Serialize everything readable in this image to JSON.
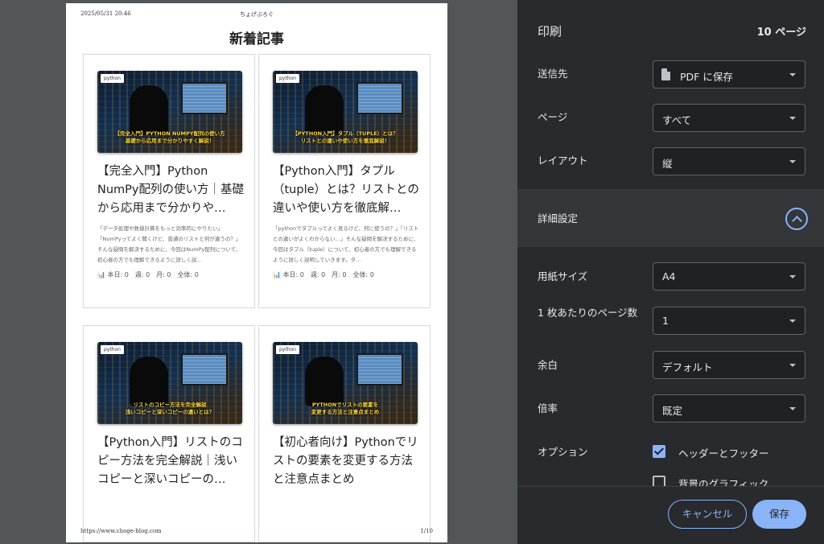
{
  "page_preview": {
    "header_date": "2025/05/31 20:46",
    "header_site": "ちょげぶろぐ",
    "section_title": "新着記事",
    "footer_url": "https://www.choge-blog.com",
    "footer_page": "1/10",
    "cards": [
      {
        "tag": "python",
        "banner": "【完全入門】PYTHON NUMPY配列の使い方\n基礎から応用まで分かりやすく解説！",
        "title": "【完全入門】Python NumPy配列の使い方｜基礎から応用まで分かりや…",
        "excerpt": "「データ処理や数値計算をもっと効率的にやりたい」「NumPyってよく聞くけど、普通のリストと何が違うの？」そんな疑問を解決するために、今回はNumPy配列について、初心者の方でも理解できるように詳しく説…",
        "stats": "📊 本日: 0　週: 0　月: 0　全体: 0"
      },
      {
        "tag": "python",
        "banner": "【PYTHON入門】タプル（TUPLE）とは？\nリストとの違いや使い方を徹底解説！",
        "title": "【Python入門】タプル（tuple）とは？リストとの違いや使い方を徹底解…",
        "excerpt": "「pythonでタプルってよく見るけど、何に使うの？」「リストとの違いがよくわからない…」そんな疑問を解決するために、今回はタプル（tuple）について、初心者の方でも理解できるように詳しく説明していきます。タ…",
        "stats": "📊 本日: 0　週: 0　月: 0　全体: 0"
      },
      {
        "tag": "python",
        "banner": "リストのコピー方法を完全解説\n浅いコピーと深いコピーの違いとは？",
        "title": "【Python入門】リストのコピー方法を完全解説｜浅いコピーと深いコピーの…",
        "excerpt": "",
        "stats": ""
      },
      {
        "tag": "python",
        "banner": "PYTHONでリストの要素を\n変更する方法と注意点まとめ",
        "title": "【初心者向け】Pythonでリストの要素を変更する方法と注意点まとめ",
        "excerpt": "",
        "stats": ""
      }
    ]
  },
  "panel": {
    "title": "印刷",
    "sheet_count": "10 ページ",
    "destination": {
      "label": "送信先",
      "value": "PDF に保存",
      "icon": "document-icon"
    },
    "pages": {
      "label": "ページ",
      "value": "すべて"
    },
    "layout": {
      "label": "レイアウト",
      "value": "縦"
    },
    "more_settings": {
      "label": "詳細設定",
      "expanded": true
    },
    "paper_size": {
      "label": "用紙サイズ",
      "value": "A4"
    },
    "pages_per_sheet": {
      "label": "1 枚あたりのページ数",
      "value": "1"
    },
    "margins": {
      "label": "余白",
      "value": "デフォルト"
    },
    "scale": {
      "label": "倍率",
      "value": "既定"
    },
    "options": {
      "label": "オプション",
      "headers_footers": {
        "label": "ヘッダーとフッター",
        "checked": true
      },
      "background_graphics": {
        "label": "背景のグラフィック",
        "checked": false
      }
    },
    "cancel_label": "キャンセル",
    "save_label": "保存",
    "accent_color": "#8ab4f8"
  }
}
